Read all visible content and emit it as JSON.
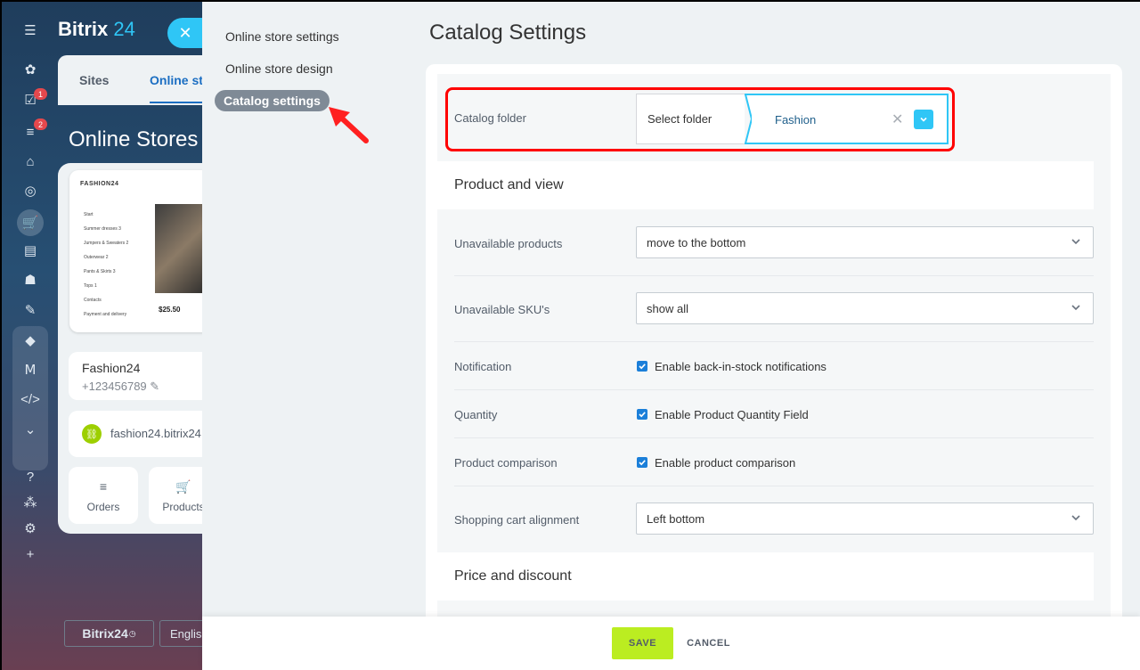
{
  "background": {
    "logo_text": "Bitrix",
    "logo_num": "24",
    "tabs": [
      "Sites",
      "Online st"
    ],
    "page_title": "Online Stores",
    "preview": {
      "brand": "FASHION24",
      "menu": [
        "Start",
        "Summer dresses 3",
        "Jumpers & Sweaters 2",
        "Outerwear 2",
        "Pants & Skirts 3",
        "Tops 1",
        "Contacts",
        "Payment and delivery"
      ],
      "price": "$25.50"
    },
    "store_name": "Fashion24",
    "store_phone": "+123456789",
    "store_domain": "fashion24.bitrix24.",
    "tiles": [
      "Orders",
      "Products"
    ],
    "footer_logo": "Bitrix24",
    "footer_lang": "Englis",
    "rail_badges": [
      "1",
      "2"
    ]
  },
  "nav": {
    "items": [
      "Online store settings",
      "Online store design"
    ],
    "active": "Catalog settings"
  },
  "page_title": "Catalog Settings",
  "catalog": {
    "label": "Catalog folder",
    "select_label": "Select folder",
    "value": "Fashion"
  },
  "sections": {
    "product_view": "Product and view",
    "price_discount": "Price and discount"
  },
  "fields": {
    "unavailable_products": {
      "label": "Unavailable products",
      "value": "move to the bottom"
    },
    "unavailable_skus": {
      "label": "Unavailable SKU's",
      "value": "show all"
    },
    "notification": {
      "label": "Notification",
      "check": "Enable back-in-stock notifications"
    },
    "quantity": {
      "label": "Quantity",
      "check": "Enable Product Quantity Field"
    },
    "comparison": {
      "label": "Product comparison",
      "check": "Enable product comparison"
    },
    "cart_alignment": {
      "label": "Shopping cart alignment",
      "value": "Left bottom"
    }
  },
  "footer": {
    "save": "SAVE",
    "cancel": "CANCEL"
  },
  "colors": {
    "accent": "#2fc6f6",
    "save": "#bbed21",
    "highlight": "#ff0000",
    "checkbox": "#1b7fd9"
  }
}
